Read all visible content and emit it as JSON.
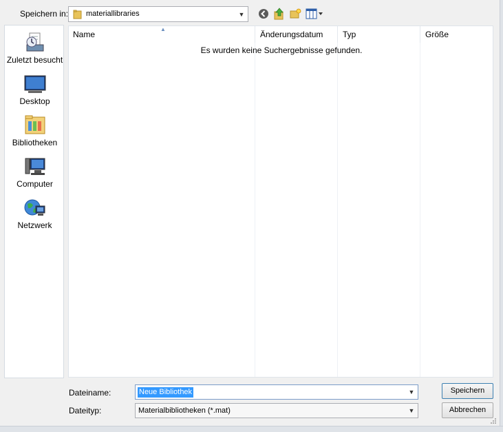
{
  "toolbar": {
    "save_in_label": "Speichern in:",
    "location": "materiallibraries",
    "icons": [
      "back-icon",
      "up-folder-icon",
      "new-folder-icon",
      "view-menu-icon"
    ]
  },
  "places": [
    {
      "label": "Zuletzt besucht",
      "icon": "recent-places-icon"
    },
    {
      "label": "Desktop",
      "icon": "desktop-icon"
    },
    {
      "label": "Bibliotheken",
      "icon": "libraries-icon"
    },
    {
      "label": "Computer",
      "icon": "computer-icon"
    },
    {
      "label": "Netzwerk",
      "icon": "network-icon"
    }
  ],
  "filelist": {
    "columns": [
      "Name",
      "Änderungsdatum",
      "Typ",
      "Größe"
    ],
    "empty_message": "Es wurden keine Suchergebnisse gefunden."
  },
  "footer": {
    "filename_label": "Dateiname:",
    "filename_value": "Neue Bibliothek",
    "filetype_label": "Dateityp:",
    "filetype_value": "Materialbibliotheken (*.mat)",
    "save_button": "Speichern",
    "cancel_button": "Abbrechen"
  }
}
